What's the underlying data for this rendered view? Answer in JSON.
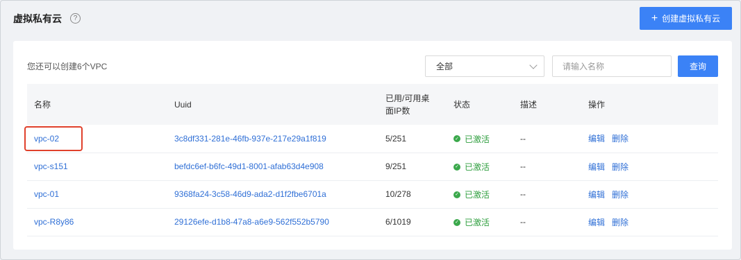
{
  "header": {
    "title": "虚拟私有云",
    "help_icon": "question-circle-icon",
    "create_label": "创建虚拟私有云"
  },
  "toolbar": {
    "quota_text": "您还可以创建6个VPC",
    "status_filter": "全部",
    "search_placeholder": "请输入名称",
    "query_label": "查询"
  },
  "table": {
    "columns": {
      "name": "名称",
      "uuid": "Uuid",
      "desktops": "已用/可用桌面IP数",
      "status": "状态",
      "desc": "描述",
      "actions": "操作"
    },
    "rows": [
      {
        "name": "vpc-02",
        "uuid": "3c8df331-281e-46fb-937e-217e29a1f819",
        "desktops": "5/251",
        "status": "已激活",
        "desc": "--",
        "edit": "编辑",
        "delete": "删除"
      },
      {
        "name": "vpc-s151",
        "uuid": "befdc6ef-b6fc-49d1-8001-afab63d4e908",
        "desktops": "9/251",
        "status": "已激活",
        "desc": "--",
        "edit": "编辑",
        "delete": "删除"
      },
      {
        "name": "vpc-01",
        "uuid": "9368fa24-3c58-46d9-ada2-d1f2fbe6701a",
        "desktops": "10/278",
        "status": "已激活",
        "desc": "--",
        "edit": "编辑",
        "delete": "删除"
      },
      {
        "name": "vpc-R8y86",
        "uuid": "29126efe-d1b8-47a8-a6e9-562f552b5790",
        "desktops": "6/1019",
        "status": "已激活",
        "desc": "--",
        "edit": "编辑",
        "delete": "删除"
      }
    ]
  },
  "colors": {
    "primary": "#3b82f6",
    "link": "#2f6fd6",
    "success": "#3aa84b",
    "highlight": "#e0402b"
  }
}
